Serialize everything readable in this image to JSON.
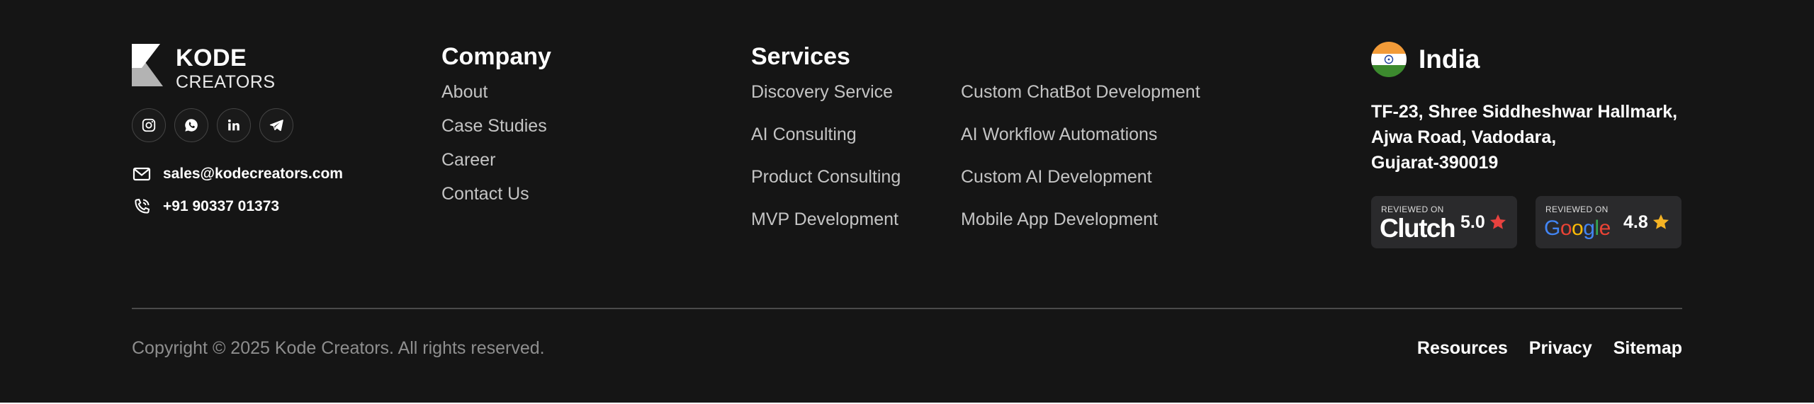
{
  "brand": {
    "name": "KODE",
    "sub": "CREATORS",
    "logo_icon": "kode-logo-icon"
  },
  "socials": [
    {
      "icon": "instagram-icon"
    },
    {
      "icon": "whatsapp-icon"
    },
    {
      "icon": "linkedin-icon"
    },
    {
      "icon": "telegram-icon"
    }
  ],
  "contact": {
    "email": "sales@kodecreators.com",
    "email_icon": "mail-icon",
    "phone": "+91 90337 01373",
    "phone_icon": "phone-icon"
  },
  "company": {
    "heading": "Company",
    "links": [
      "About",
      "Case Studies",
      "Career",
      "Contact Us"
    ]
  },
  "services": {
    "heading": "Services",
    "col1": [
      "Discovery Service",
      "AI Consulting",
      "Product Consulting",
      "MVP Development"
    ],
    "col2": [
      "Custom ChatBot Development",
      "AI Workflow Automations",
      "Custom AI Development",
      "Mobile App Development"
    ]
  },
  "location": {
    "heading": "India",
    "flag_icon": "india-flag-icon",
    "address": [
      "TF-23, Shree Siddheshwar Hallmark,",
      "Ajwa Road, Vadodara,",
      "Gujarat-390019"
    ]
  },
  "reviews": [
    {
      "label": "REVIEWED ON",
      "platform": "Clutch",
      "score": "5.0",
      "star_color": "#e8423f"
    },
    {
      "label": "REVIEWED ON",
      "platform": "Google",
      "score": "4.8",
      "star_color": "#f5b324"
    }
  ],
  "footer": {
    "copyright": "Copyright © 2025 Kode Creators. All rights reserved.",
    "links": [
      "Resources",
      "Privacy",
      "Sitemap"
    ]
  },
  "colors": {
    "background": "#151515",
    "muted_text": "#c4c4c4",
    "copyright_text": "#8e8e8e"
  }
}
